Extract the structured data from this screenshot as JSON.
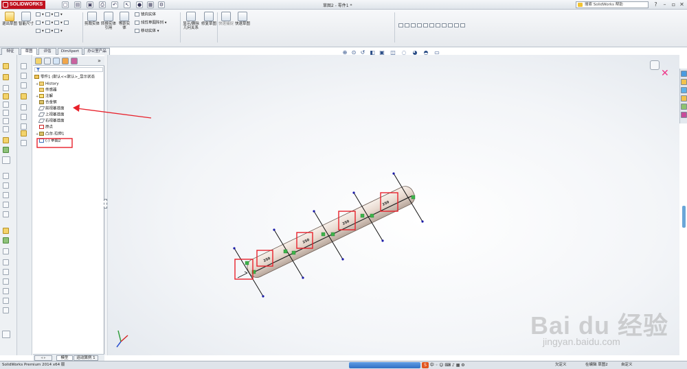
{
  "app": {
    "brand": "SOLIDWORKS",
    "document_title": "草图2 - 零件1 *",
    "help_search_placeholder": "搜索 SolidWorks 帮助"
  },
  "commands": {
    "exit_sketch": "退出草图",
    "smart_dimension": "智能尺寸",
    "trim_entities": "剪裁实体",
    "convert_entities": "转换实体引用",
    "offset_entities": "等距实体",
    "mirror_entities": "镜向实体",
    "linear_pattern": "线性草图阵列",
    "move_entities": "移动实体",
    "display_delete_relations": "显示/删除几何关系",
    "repair_sketch": "修复草图",
    "quick_snaps": "快速捕捉",
    "rapid_sketch": "快速草图"
  },
  "cmd_tabs": [
    "特征",
    "草图",
    "评估",
    "DimXpert",
    "办公室产品"
  ],
  "feature_tree": {
    "root": "零件1 (默认<<默认>_显示状态",
    "items": [
      {
        "label": "History",
        "type": "folder"
      },
      {
        "label": "传感器",
        "type": "folder"
      },
      {
        "label": "注解",
        "type": "ann"
      },
      {
        "label": "合金钢",
        "type": "feat"
      },
      {
        "label": "前视基准面",
        "type": "plane"
      },
      {
        "label": "上视基准面",
        "type": "plane"
      },
      {
        "label": "右视基准面",
        "type": "plane"
      },
      {
        "label": "原点",
        "type": "origin"
      },
      {
        "label": "凸台-拉伸1",
        "type": "feat"
      },
      {
        "label": "(-) 草图2",
        "type": "sk"
      }
    ]
  },
  "bottom_tabs": [
    "模型",
    "运动算例 1"
  ],
  "dimensions": [
    "250",
    "250",
    "250",
    "250",
    "250"
  ],
  "status": {
    "left": "SolidWorks Premium 2014 x64 版",
    "sketch_state": "欠定义",
    "editing": "在编辑 草图2",
    "units": "自定义"
  },
  "watermark": {
    "main": "Bai du 经验",
    "sub": "jingyan.baidu.com"
  },
  "colors": {
    "brand_red": "#c1121f",
    "highlight_red": "#e8202a",
    "sketch_point": "#1a1aa8",
    "relation_green": "#3cb34a"
  }
}
